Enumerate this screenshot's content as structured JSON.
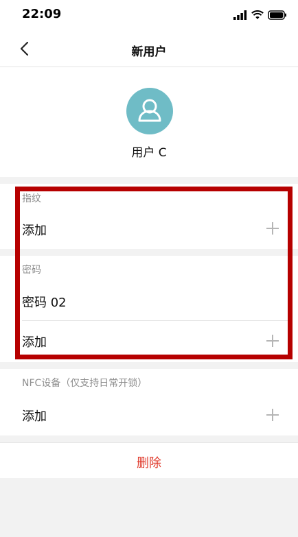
{
  "status_bar": {
    "time": "22:09"
  },
  "nav": {
    "title": "新用户"
  },
  "profile": {
    "user_name": "用户 C",
    "avatar_color": "#6fbcc6"
  },
  "fingerprint": {
    "title": "指纹",
    "add_label": "添加"
  },
  "password": {
    "title": "密码",
    "items": [
      "密码 02"
    ],
    "add_label": "添加"
  },
  "nfc": {
    "title": "NFC设备（仅支持日常开锁）",
    "add_label": "添加"
  },
  "actions": {
    "delete_label": "删除"
  },
  "colors": {
    "accent_red": "#e0392b",
    "highlight_red": "#b60000"
  }
}
